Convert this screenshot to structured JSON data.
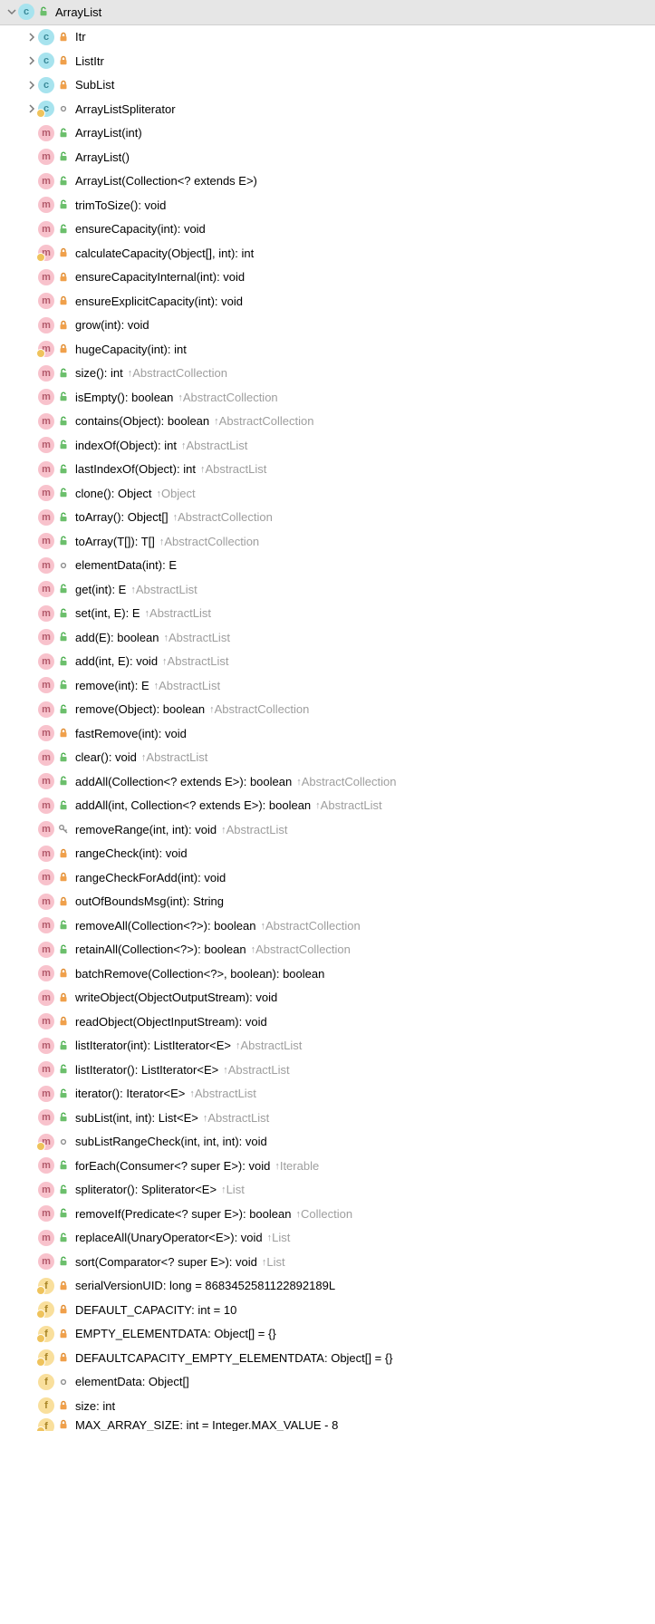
{
  "rows": [
    {
      "indent": 0,
      "arrow": "down",
      "kind": "c",
      "access": "public",
      "static": false,
      "label": "ArrayList",
      "override": "",
      "header": true
    },
    {
      "indent": 1,
      "arrow": "right",
      "kind": "c",
      "access": "private",
      "static": false,
      "label": "Itr",
      "override": ""
    },
    {
      "indent": 1,
      "arrow": "right",
      "kind": "c",
      "access": "private",
      "static": false,
      "label": "ListItr",
      "override": ""
    },
    {
      "indent": 1,
      "arrow": "right",
      "kind": "c",
      "access": "private",
      "static": false,
      "label": "SubList",
      "override": ""
    },
    {
      "indent": 1,
      "arrow": "right",
      "kind": "c",
      "access": "package",
      "static": true,
      "label": "ArrayListSpliterator",
      "override": ""
    },
    {
      "indent": 1,
      "arrow": "",
      "kind": "m",
      "access": "public",
      "static": false,
      "label": "ArrayList(int)",
      "override": ""
    },
    {
      "indent": 1,
      "arrow": "",
      "kind": "m",
      "access": "public",
      "static": false,
      "label": "ArrayList()",
      "override": ""
    },
    {
      "indent": 1,
      "arrow": "",
      "kind": "m",
      "access": "public",
      "static": false,
      "label": "ArrayList(Collection<? extends E>)",
      "override": ""
    },
    {
      "indent": 1,
      "arrow": "",
      "kind": "m",
      "access": "public",
      "static": false,
      "label": "trimToSize(): void",
      "override": ""
    },
    {
      "indent": 1,
      "arrow": "",
      "kind": "m",
      "access": "public",
      "static": false,
      "label": "ensureCapacity(int): void",
      "override": ""
    },
    {
      "indent": 1,
      "arrow": "",
      "kind": "m",
      "access": "private",
      "static": true,
      "label": "calculateCapacity(Object[], int): int",
      "override": ""
    },
    {
      "indent": 1,
      "arrow": "",
      "kind": "m",
      "access": "private",
      "static": false,
      "label": "ensureCapacityInternal(int): void",
      "override": ""
    },
    {
      "indent": 1,
      "arrow": "",
      "kind": "m",
      "access": "private",
      "static": false,
      "label": "ensureExplicitCapacity(int): void",
      "override": ""
    },
    {
      "indent": 1,
      "arrow": "",
      "kind": "m",
      "access": "private",
      "static": false,
      "label": "grow(int): void",
      "override": ""
    },
    {
      "indent": 1,
      "arrow": "",
      "kind": "m",
      "access": "private",
      "static": true,
      "label": "hugeCapacity(int): int",
      "override": ""
    },
    {
      "indent": 1,
      "arrow": "",
      "kind": "m",
      "access": "public",
      "static": false,
      "label": "size(): int",
      "override": "AbstractCollection"
    },
    {
      "indent": 1,
      "arrow": "",
      "kind": "m",
      "access": "public",
      "static": false,
      "label": "isEmpty(): boolean",
      "override": "AbstractCollection"
    },
    {
      "indent": 1,
      "arrow": "",
      "kind": "m",
      "access": "public",
      "static": false,
      "label": "contains(Object): boolean",
      "override": "AbstractCollection"
    },
    {
      "indent": 1,
      "arrow": "",
      "kind": "m",
      "access": "public",
      "static": false,
      "label": "indexOf(Object): int",
      "override": "AbstractList"
    },
    {
      "indent": 1,
      "arrow": "",
      "kind": "m",
      "access": "public",
      "static": false,
      "label": "lastIndexOf(Object): int",
      "override": "AbstractList"
    },
    {
      "indent": 1,
      "arrow": "",
      "kind": "m",
      "access": "public",
      "static": false,
      "label": "clone(): Object",
      "override": "Object"
    },
    {
      "indent": 1,
      "arrow": "",
      "kind": "m",
      "access": "public",
      "static": false,
      "label": "toArray(): Object[]",
      "override": "AbstractCollection"
    },
    {
      "indent": 1,
      "arrow": "",
      "kind": "m",
      "access": "public",
      "static": false,
      "label": "toArray(T[]): T[]",
      "override": "AbstractCollection"
    },
    {
      "indent": 1,
      "arrow": "",
      "kind": "m",
      "access": "package",
      "static": false,
      "label": "elementData(int): E",
      "override": ""
    },
    {
      "indent": 1,
      "arrow": "",
      "kind": "m",
      "access": "public",
      "static": false,
      "label": "get(int): E",
      "override": "AbstractList"
    },
    {
      "indent": 1,
      "arrow": "",
      "kind": "m",
      "access": "public",
      "static": false,
      "label": "set(int, E): E",
      "override": "AbstractList"
    },
    {
      "indent": 1,
      "arrow": "",
      "kind": "m",
      "access": "public",
      "static": false,
      "label": "add(E): boolean",
      "override": "AbstractList"
    },
    {
      "indent": 1,
      "arrow": "",
      "kind": "m",
      "access": "public",
      "static": false,
      "label": "add(int, E): void",
      "override": "AbstractList"
    },
    {
      "indent": 1,
      "arrow": "",
      "kind": "m",
      "access": "public",
      "static": false,
      "label": "remove(int): E",
      "override": "AbstractList"
    },
    {
      "indent": 1,
      "arrow": "",
      "kind": "m",
      "access": "public",
      "static": false,
      "label": "remove(Object): boolean",
      "override": "AbstractCollection"
    },
    {
      "indent": 1,
      "arrow": "",
      "kind": "m",
      "access": "private",
      "static": false,
      "label": "fastRemove(int): void",
      "override": ""
    },
    {
      "indent": 1,
      "arrow": "",
      "kind": "m",
      "access": "public",
      "static": false,
      "label": "clear(): void",
      "override": "AbstractList"
    },
    {
      "indent": 1,
      "arrow": "",
      "kind": "m",
      "access": "public",
      "static": false,
      "label": "addAll(Collection<? extends E>): boolean",
      "override": "AbstractCollection"
    },
    {
      "indent": 1,
      "arrow": "",
      "kind": "m",
      "access": "public",
      "static": false,
      "label": "addAll(int, Collection<? extends E>): boolean",
      "override": "AbstractList"
    },
    {
      "indent": 1,
      "arrow": "",
      "kind": "m",
      "access": "protected",
      "static": false,
      "label": "removeRange(int, int): void",
      "override": "AbstractList"
    },
    {
      "indent": 1,
      "arrow": "",
      "kind": "m",
      "access": "private",
      "static": false,
      "label": "rangeCheck(int): void",
      "override": ""
    },
    {
      "indent": 1,
      "arrow": "",
      "kind": "m",
      "access": "private",
      "static": false,
      "label": "rangeCheckForAdd(int): void",
      "override": ""
    },
    {
      "indent": 1,
      "arrow": "",
      "kind": "m",
      "access": "private",
      "static": false,
      "label": "outOfBoundsMsg(int): String",
      "override": ""
    },
    {
      "indent": 1,
      "arrow": "",
      "kind": "m",
      "access": "public",
      "static": false,
      "label": "removeAll(Collection<?>): boolean",
      "override": "AbstractCollection"
    },
    {
      "indent": 1,
      "arrow": "",
      "kind": "m",
      "access": "public",
      "static": false,
      "label": "retainAll(Collection<?>): boolean",
      "override": "AbstractCollection"
    },
    {
      "indent": 1,
      "arrow": "",
      "kind": "m",
      "access": "private",
      "static": false,
      "label": "batchRemove(Collection<?>, boolean): boolean",
      "override": ""
    },
    {
      "indent": 1,
      "arrow": "",
      "kind": "m",
      "access": "private",
      "static": false,
      "label": "writeObject(ObjectOutputStream): void",
      "override": ""
    },
    {
      "indent": 1,
      "arrow": "",
      "kind": "m",
      "access": "private",
      "static": false,
      "label": "readObject(ObjectInputStream): void",
      "override": ""
    },
    {
      "indent": 1,
      "arrow": "",
      "kind": "m",
      "access": "public",
      "static": false,
      "label": "listIterator(int): ListIterator<E>",
      "override": "AbstractList"
    },
    {
      "indent": 1,
      "arrow": "",
      "kind": "m",
      "access": "public",
      "static": false,
      "label": "listIterator(): ListIterator<E>",
      "override": "AbstractList"
    },
    {
      "indent": 1,
      "arrow": "",
      "kind": "m",
      "access": "public",
      "static": false,
      "label": "iterator(): Iterator<E>",
      "override": "AbstractList"
    },
    {
      "indent": 1,
      "arrow": "",
      "kind": "m",
      "access": "public",
      "static": false,
      "label": "subList(int, int): List<E>",
      "override": "AbstractList"
    },
    {
      "indent": 1,
      "arrow": "",
      "kind": "m",
      "access": "package",
      "static": true,
      "label": "subListRangeCheck(int, int, int): void",
      "override": ""
    },
    {
      "indent": 1,
      "arrow": "",
      "kind": "m",
      "access": "public",
      "static": false,
      "label": "forEach(Consumer<? super E>): void",
      "override": "Iterable"
    },
    {
      "indent": 1,
      "arrow": "",
      "kind": "m",
      "access": "public",
      "static": false,
      "label": "spliterator(): Spliterator<E>",
      "override": "List"
    },
    {
      "indent": 1,
      "arrow": "",
      "kind": "m",
      "access": "public",
      "static": false,
      "label": "removeIf(Predicate<? super E>): boolean",
      "override": "Collection"
    },
    {
      "indent": 1,
      "arrow": "",
      "kind": "m",
      "access": "public",
      "static": false,
      "label": "replaceAll(UnaryOperator<E>): void",
      "override": "List"
    },
    {
      "indent": 1,
      "arrow": "",
      "kind": "m",
      "access": "public",
      "static": false,
      "label": "sort(Comparator<? super E>): void",
      "override": "List"
    },
    {
      "indent": 1,
      "arrow": "",
      "kind": "f",
      "access": "private",
      "static": true,
      "label": "serialVersionUID: long = 8683452581122892189L",
      "override": ""
    },
    {
      "indent": 1,
      "arrow": "",
      "kind": "f",
      "access": "private",
      "static": true,
      "label": "DEFAULT_CAPACITY: int = 10",
      "override": ""
    },
    {
      "indent": 1,
      "arrow": "",
      "kind": "f",
      "access": "private",
      "static": true,
      "label": "EMPTY_ELEMENTDATA: Object[] = {}",
      "override": ""
    },
    {
      "indent": 1,
      "arrow": "",
      "kind": "f",
      "access": "private",
      "static": true,
      "label": "DEFAULTCAPACITY_EMPTY_ELEMENTDATA: Object[] = {}",
      "override": ""
    },
    {
      "indent": 1,
      "arrow": "",
      "kind": "f",
      "access": "package",
      "static": false,
      "label": "elementData: Object[]",
      "override": ""
    },
    {
      "indent": 1,
      "arrow": "",
      "kind": "f",
      "access": "private",
      "static": false,
      "label": "size: int",
      "override": ""
    },
    {
      "indent": 1,
      "arrow": "",
      "kind": "f",
      "access": "private",
      "static": true,
      "label": "MAX_ARRAY_SIZE: int = Integer.MAX_VALUE - 8",
      "override": ""
    }
  ],
  "partialLastRowHeight": 14
}
